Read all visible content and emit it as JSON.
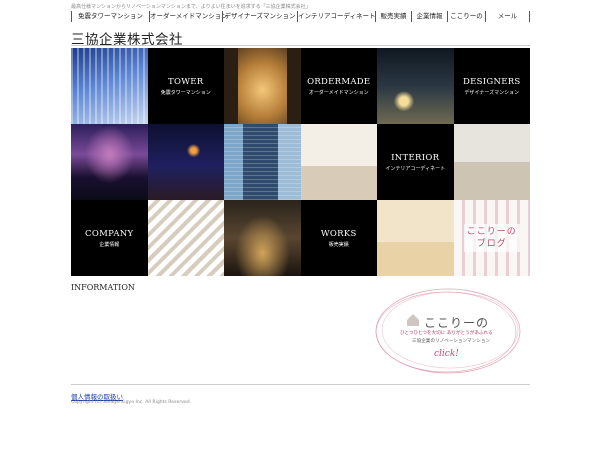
{
  "header": {
    "tagline": "最高仕様マンションからリノベーションマンションまで、よりよい住まいを追求する「三協企業株式会社」",
    "logo_text": "三協企業株式会社"
  },
  "nav": [
    {
      "label": "免震タワーマンション"
    },
    {
      "label": "オーダーメイドマンション"
    },
    {
      "label": "デザイナーズマンション"
    },
    {
      "label": "インテリアコーディネート"
    },
    {
      "label": "販売実績"
    },
    {
      "label": "企業情報"
    },
    {
      "label": "ここりーの"
    },
    {
      "label": "メール"
    }
  ],
  "tiles": {
    "tower": {
      "en": "TOWER",
      "jp": "免震タワーマンション"
    },
    "ordermade": {
      "en": "ORDERMADE",
      "jp": "オーダーメイドマンション"
    },
    "designers": {
      "en": "DESIGNERS",
      "jp": "デザイナーズマンション"
    },
    "interior": {
      "en": "INTERIOR",
      "jp": "インテリアコーディネート"
    },
    "company": {
      "en": "COMPANY",
      "jp": "企業情報"
    },
    "works": {
      "en": "WORKS",
      "jp": "販売実績"
    },
    "blog": {
      "line1": "ここりーの",
      "line2": "ブログ"
    }
  },
  "info": {
    "title": "INFORMATION"
  },
  "banner": {
    "title": "ここりーの",
    "sub1": "ひとつひとつを大切に ありがとうがあふれる",
    "sub2": "三協企業のリノベーションマンション",
    "click": "click!"
  },
  "footer": {
    "privacy": "個人情報の取扱い",
    "copyright": "Copyright (C) Sankyo Kigyo Inc. All Rights Reserved."
  },
  "colors": {
    "accent_pink": "#c04a70",
    "link_blue": "#1a3fa8",
    "tile_black": "#000000"
  }
}
